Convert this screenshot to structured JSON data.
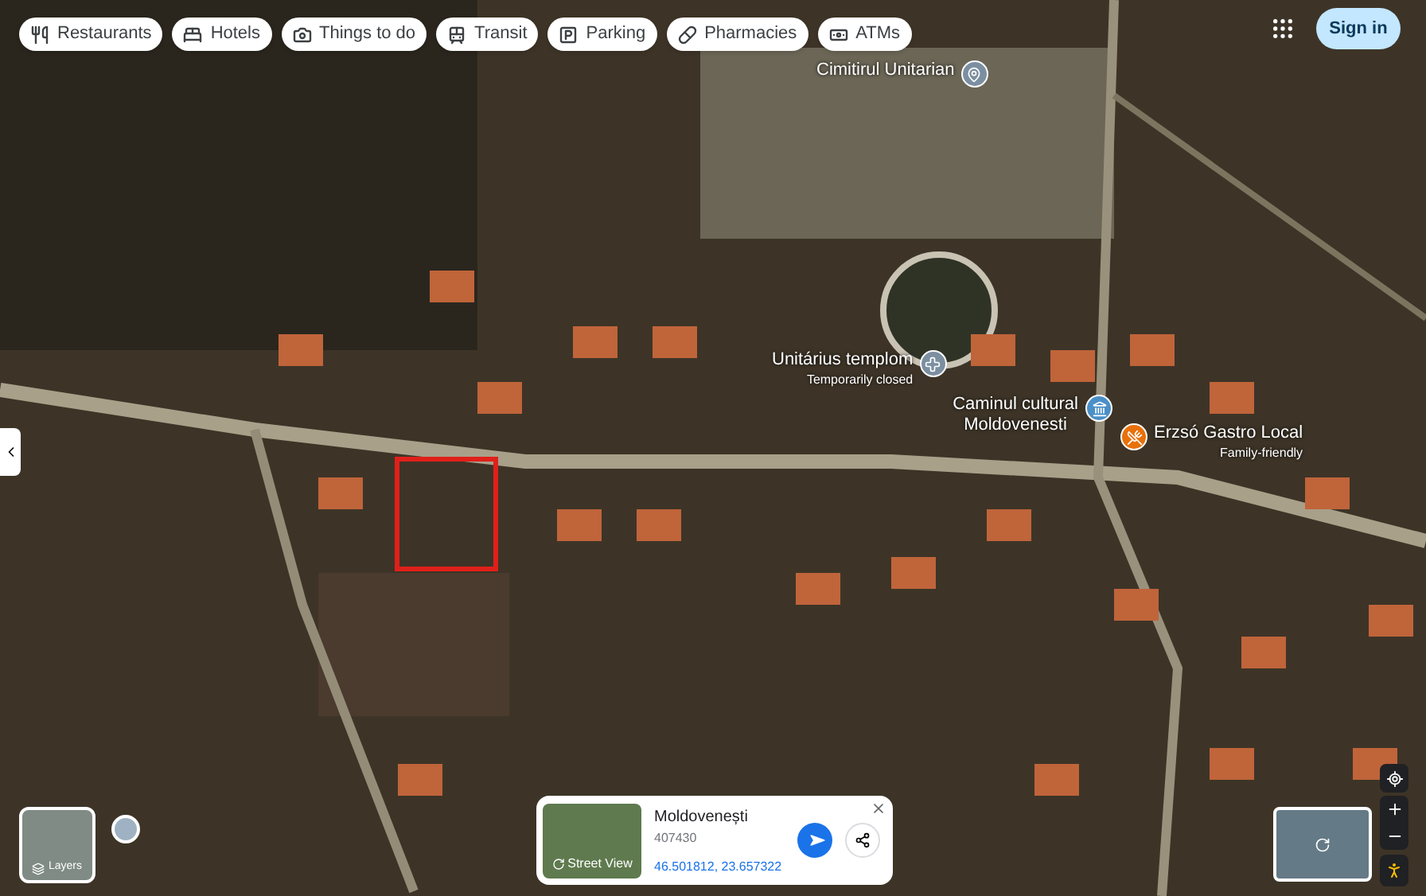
{
  "chips": [
    {
      "label": "Restaurants",
      "kind": "restaurant"
    },
    {
      "label": "Hotels",
      "kind": "hotel"
    },
    {
      "label": "Things to do",
      "kind": "camera"
    },
    {
      "label": "Transit",
      "kind": "transit"
    },
    {
      "label": "Parking",
      "kind": "parking"
    },
    {
      "label": "Pharmacies",
      "kind": "pharmacy"
    },
    {
      "label": "ATMs",
      "kind": "atm"
    }
  ],
  "sign_in": "Sign in",
  "map_labels": [
    {
      "name": "Cimitirul Unitarian",
      "kind": "cemetery"
    },
    {
      "name": "Unitárius templom",
      "sublabel": "Temporarily closed",
      "kind": "church"
    },
    {
      "name": "Caminul cultural Moldovenesti",
      "kind": "culture"
    },
    {
      "name": "Erzsó Gastro Local",
      "sublabel": "Family-friendly",
      "kind": "food"
    }
  ],
  "place_card": {
    "title": "Moldovenești",
    "postcode": "407430",
    "coordinates": "46.501812, 23.657322",
    "thumbnail_label": "Street View"
  },
  "layers": {
    "label": "Layers"
  }
}
